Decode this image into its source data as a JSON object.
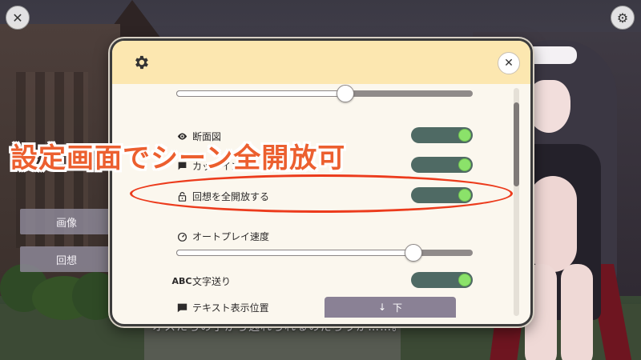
{
  "scene": {
    "subtitle": "オスたちの手から逃れられるのだろうか……。"
  },
  "corner": {
    "close_glyph": "✕",
    "settings_glyph": "⚙"
  },
  "side_menu": {
    "items": [
      {
        "label": "画像"
      },
      {
        "label": "回想"
      }
    ]
  },
  "dialog": {
    "close_glyph": "✕",
    "top_slider_value": 0.57,
    "settings": [
      {
        "label": "断面図",
        "icon": "eye-icon",
        "type": "toggle",
        "on": true
      },
      {
        "label": "カットインメッセージ表示",
        "icon": "chat-icon",
        "type": "toggle",
        "on": true
      },
      {
        "label": "回想を全開放する",
        "icon": "lock-icon",
        "type": "toggle",
        "on": true
      },
      {
        "label": "オートプレイ速度",
        "icon": "speedometer-icon",
        "type": "slider",
        "value": 0.8
      },
      {
        "label": "文字送り",
        "icon": "abc-icon",
        "icon_text": "ABC",
        "type": "toggle",
        "on": true
      },
      {
        "label": "テキスト表示位置",
        "icon": "message-icon",
        "type": "button",
        "button_label": "下",
        "button_arrow": "↓"
      }
    ],
    "colors": {
      "header": "#fce7b0",
      "toggle_track": "#4f6a64",
      "toggle_knob": "#8be26a"
    }
  },
  "overlay": {
    "caption": "設定画面でシーン全開放可",
    "ring_color": "#ec3b1c",
    "caption_color": "#ec5f2f"
  }
}
